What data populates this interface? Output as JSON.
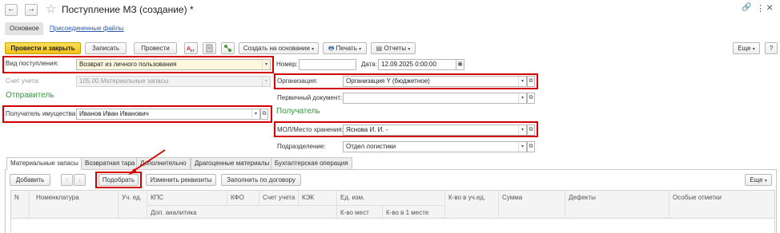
{
  "window": {
    "title": "Поступление МЗ (создание) *",
    "controls": {
      "link": "🔗",
      "more": "⋮",
      "close": "×"
    }
  },
  "nav": {
    "back": "←",
    "forward": "→",
    "star": "☆"
  },
  "viewtabs": {
    "main": "Основное",
    "attached": "Присоединенные файлы"
  },
  "toolbar": {
    "post_close": "Провести и закрыть",
    "save": "Записать",
    "post": "Провести",
    "create_based": "Создать на основании",
    "print": "Печать",
    "reports": "Отчеты",
    "more": "Еще",
    "help": "?"
  },
  "header": {
    "receipt_type_label": "Вид поступления:",
    "receipt_type_value": "Возврат из личного пользования",
    "number_label": "Номер:",
    "number_value": "",
    "date_label": "Дата:",
    "date_value": "12.09.2025  0:00:00",
    "account_label": "Счет учета:",
    "account_value": "105.00.Материальные запасы",
    "org_label": "Организация:",
    "org_value": "Организация Y (бюджетное)",
    "primary_doc_label": "Первичный документ:",
    "primary_doc_value": ""
  },
  "sender": {
    "title": "Отправитель",
    "recipient_label": "Получатель имущества:",
    "recipient_value": "Иванов Иван Иванович"
  },
  "receiver": {
    "title": "Получатель",
    "mol_label": "МОЛ/Место хранения:",
    "mol_value": "Яснова И. И. -",
    "dept_label": "Подразделение:",
    "dept_value": "Отдел логистики"
  },
  "tabs": [
    "Материальные запасы",
    "Возвратная тара",
    "Дополнительно",
    "Драгоценные материалы",
    "Бухгалтерская операция"
  ],
  "table_toolbar": {
    "add": "Добавить",
    "up": "↑",
    "down": "↓",
    "pick": "Подобрать",
    "change": "Изменить реквизиты",
    "fill": "Заполнить по договору",
    "more": "Еще"
  },
  "table": {
    "row1": [
      "N",
      "Номенклатура",
      "Уч. ед.",
      "КПС",
      "КФО",
      "Счет учета",
      "КЭК",
      "Ед. изм.",
      "К-во в уч.ед.",
      "Сумма",
      "Дефекты",
      "Особые отметки"
    ],
    "row2": [
      "Доп. аналитика",
      "К-во мест",
      "К-во в 1 месте"
    ]
  },
  "colors": {
    "highlight": "#d40000",
    "section": "#2f9a3a",
    "primary": "#f2c014",
    "arrow": "#d40000"
  }
}
